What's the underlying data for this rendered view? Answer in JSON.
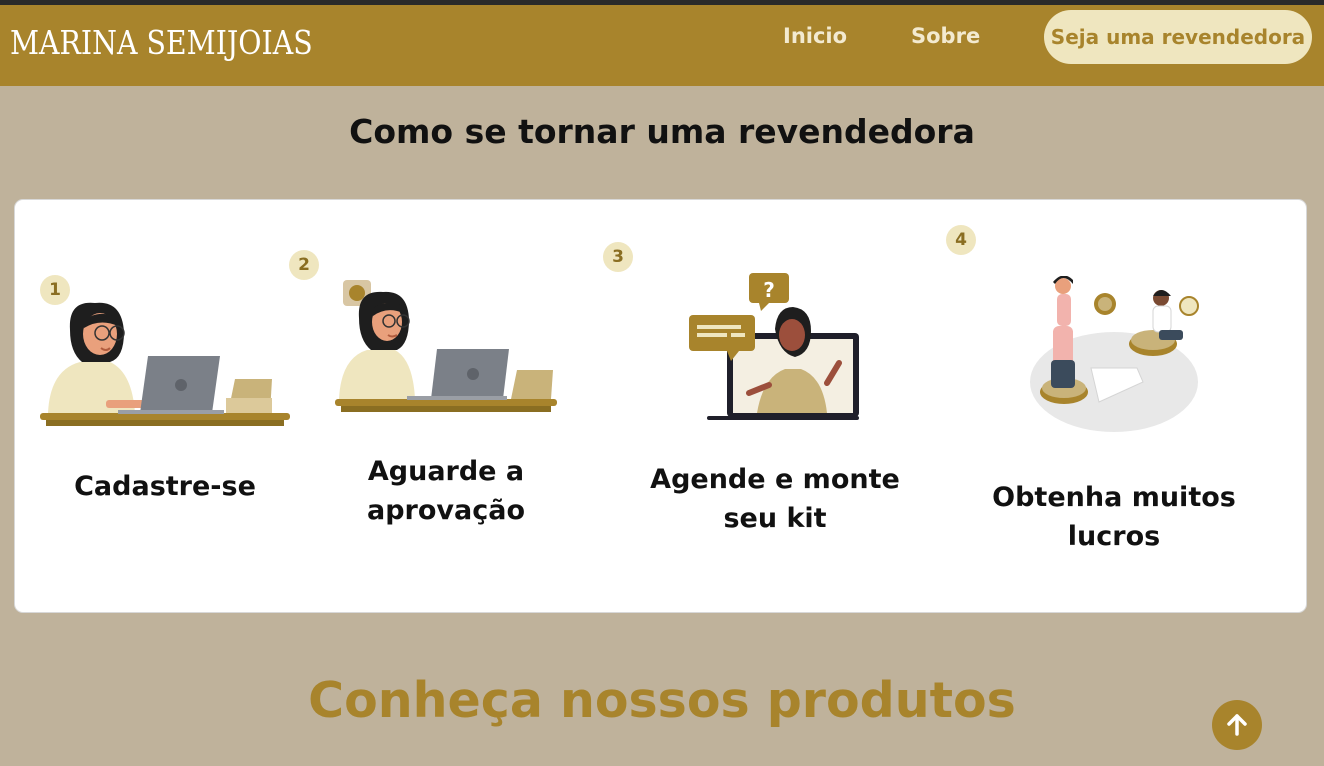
{
  "brand": {
    "logo_text": "MARINA SEMIJOIAS"
  },
  "nav": {
    "items": [
      {
        "label": "Inicio"
      },
      {
        "label": "Sobre"
      }
    ],
    "cta_label": "Seja uma revendedora"
  },
  "how_to": {
    "title": "Como se tornar uma revendedora",
    "steps": [
      {
        "number": "1",
        "label": "Cadastre-se",
        "icon": "woman-at-laptop-illustration"
      },
      {
        "number": "2",
        "label": "Aguarde a aprovação",
        "icon": "woman-waiting-at-laptop-illustration"
      },
      {
        "number": "3",
        "label": "Agende e monte seu kit",
        "icon": "video-call-support-illustration"
      },
      {
        "number": "4",
        "label": "Obtenha muitos lucros",
        "icon": "people-with-coins-illustration"
      }
    ]
  },
  "products": {
    "title": "Conheça nossos produtos"
  },
  "scroll_top": {
    "icon": "arrow-up-icon"
  },
  "colors": {
    "gold": "#a8842c",
    "cream": "#efe6bf",
    "background": "#bfb29b",
    "card": "#ffffff"
  }
}
